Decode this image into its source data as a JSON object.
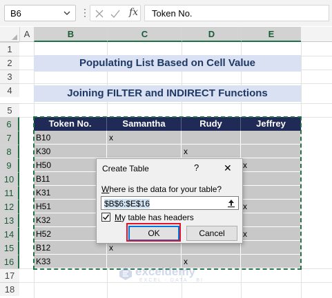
{
  "formula_bar": {
    "name_box": "B6",
    "formula": "Token No.",
    "fx_label": "fx"
  },
  "columns": [
    "A",
    "B",
    "C",
    "D",
    "E"
  ],
  "rows": [
    "1",
    "2",
    "3",
    "4",
    "5",
    "6",
    "7",
    "8",
    "9",
    "10",
    "11",
    "12",
    "13",
    "14",
    "15",
    "16",
    "17",
    "18"
  ],
  "banners": {
    "title": "Populating List Based on Cell Value",
    "subtitle": "Joining FILTER and INDIRECT Functions"
  },
  "table": {
    "headers": [
      "Token No.",
      "Samantha",
      "Rudy",
      "Jeffrey"
    ],
    "rows": [
      [
        "B10",
        "x",
        "",
        ""
      ],
      [
        "K30",
        "",
        "x",
        ""
      ],
      [
        "H50",
        "",
        "",
        "x"
      ],
      [
        "B11",
        "",
        "",
        ""
      ],
      [
        "K31",
        "",
        "",
        ""
      ],
      [
        "H51",
        "",
        "",
        "x"
      ],
      [
        "K32",
        "",
        "",
        ""
      ],
      [
        "H52",
        "",
        "",
        "x"
      ],
      [
        "B12",
        "x",
        "",
        ""
      ],
      [
        "K33",
        "",
        "x",
        ""
      ]
    ]
  },
  "dialog": {
    "title": "Create Table",
    "help": "?",
    "close": "✕",
    "question": "Where is the data for your table?",
    "range": "$B$6:$E$16",
    "checkbox_label": "My table has headers",
    "checkbox_checked": true,
    "ok_label": "OK",
    "cancel_label": "Cancel"
  },
  "watermark": {
    "name": "exceldemy",
    "tagline": "EXCEL · DATA · BI"
  },
  "colors": {
    "banner_bg": "#d9e1f2",
    "banner_text": "#1f3864",
    "table_header_bg": "#1f2a56",
    "selection_green": "#217346",
    "highlight_red": "#e2102b"
  }
}
